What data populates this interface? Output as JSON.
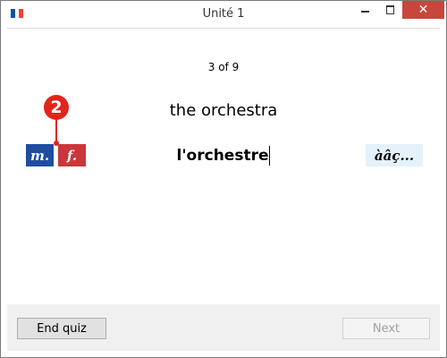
{
  "window": {
    "title": "Unité 1",
    "close_symbol": "✕"
  },
  "colors": {
    "flag_blue": "#0055a4",
    "flag_white": "#ffffff",
    "flag_red": "#ef4135",
    "masculine": "#1f4e9e",
    "feminine": "#c9373b",
    "badge": "#e1251b",
    "accent_panel": "#e5f1fb"
  },
  "quiz": {
    "progress": "3 of 9",
    "prompt": "the orchestra",
    "answer": "l'orchestre",
    "masculine_label": "m.",
    "feminine_label": "f.",
    "hint_badge": "2",
    "accent_label": "àâç..."
  },
  "footer": {
    "end_quiz_label": "End quiz",
    "next_label": "Next"
  }
}
